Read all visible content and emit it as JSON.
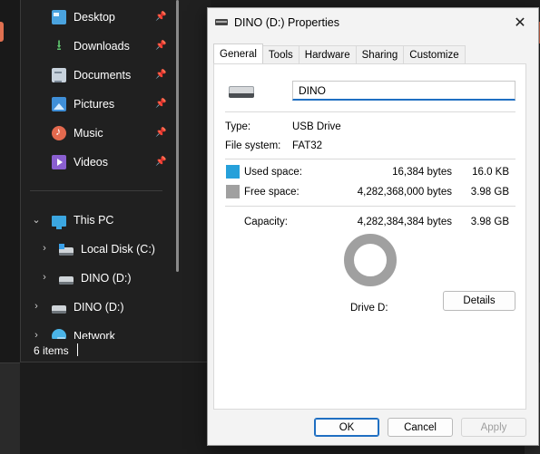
{
  "explorer": {
    "quick_access": [
      {
        "label": "Desktop",
        "icon": "desktop-icon"
      },
      {
        "label": "Downloads",
        "icon": "download-icon"
      },
      {
        "label": "Documents",
        "icon": "documents-icon"
      },
      {
        "label": "Pictures",
        "icon": "pictures-icon"
      },
      {
        "label": "Music",
        "icon": "music-icon"
      },
      {
        "label": "Videos",
        "icon": "videos-icon"
      }
    ],
    "this_pc": {
      "label": "This PC",
      "icon": "pc-icon"
    },
    "drives": [
      {
        "label": "Local Disk (C:)",
        "icon": "local-disk-icon"
      },
      {
        "label": "DINO (D:)",
        "icon": "usb-drive-icon"
      }
    ],
    "root_items": [
      {
        "label": "DINO (D:)",
        "icon": "usb-drive-icon"
      },
      {
        "label": "Network",
        "icon": "network-icon"
      }
    ],
    "status": "6 items"
  },
  "dialog": {
    "title": "DINO (D:) Properties",
    "close_glyph": "✕",
    "tabs": [
      "General",
      "Tools",
      "Hardware",
      "Sharing",
      "Customize"
    ],
    "active_tab": "General",
    "drive_name": "DINO",
    "type_label": "Type:",
    "type_value": "USB Drive",
    "fs_label": "File system:",
    "fs_value": "FAT32",
    "used": {
      "label": "Used space:",
      "bytes": "16,384 bytes",
      "size": "16.0 KB",
      "color": "#26a0da"
    },
    "free": {
      "label": "Free space:",
      "bytes": "4,282,368,000 bytes",
      "size": "3.98 GB",
      "color": "#a0a0a0"
    },
    "capacity": {
      "label": "Capacity:",
      "bytes": "4,282,384,384 bytes",
      "size": "3.98 GB"
    },
    "used_fraction": 3.8e-06,
    "drive_caption": "Drive D:",
    "details_label": "Details",
    "buttons": {
      "ok": "OK",
      "cancel": "Cancel",
      "apply": "Apply"
    }
  }
}
